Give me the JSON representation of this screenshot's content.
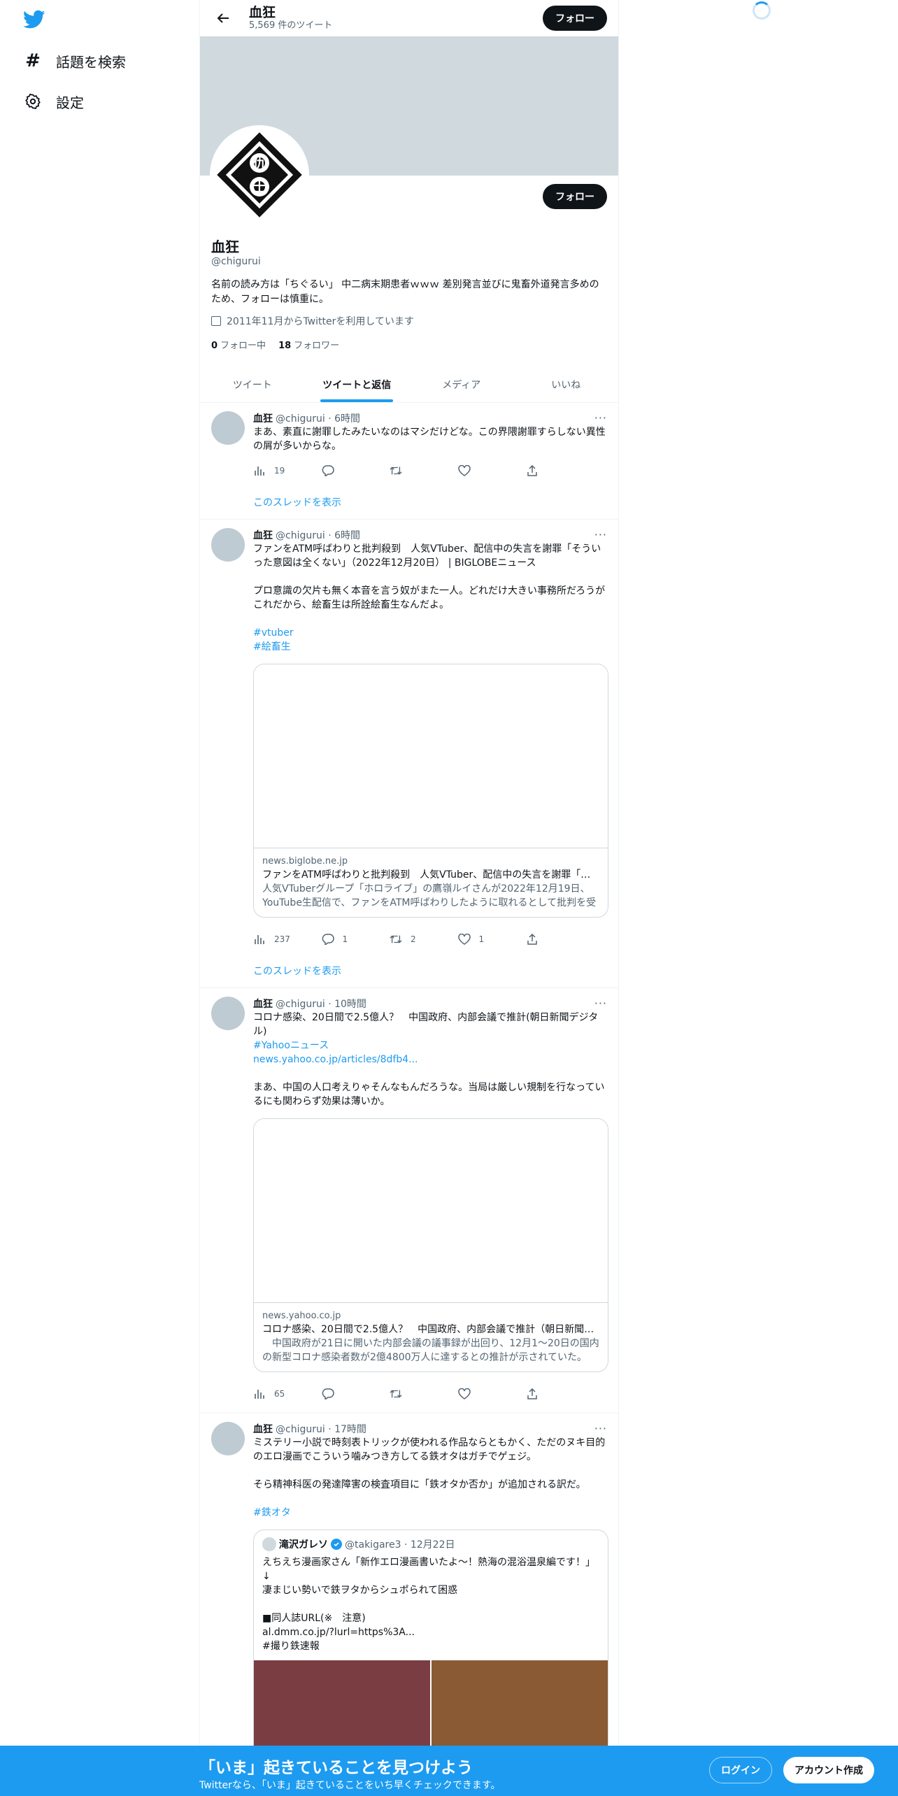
{
  "nav": {
    "logo": "twitter-bird-icon",
    "items": [
      {
        "icon": "hashtag-icon",
        "label": "話題を検索"
      },
      {
        "icon": "gear-icon",
        "label": "設定"
      }
    ]
  },
  "header": {
    "name": "血狂",
    "tweet_count": "5,569 件のツイート",
    "follow_label": "フォロー"
  },
  "profile": {
    "name": "血狂",
    "handle": "@chigurui",
    "bio": "名前の読み方は「ちぐるい」 中二病末期患者ｗｗｗ 差別発言並びに鬼畜外道発言多めのため、フォローは慎重に。",
    "joined": "2011年11月からTwitterを利用しています",
    "following_count": "0",
    "following_label": "フォロー中",
    "followers_count": "18",
    "followers_label": "フォロワー",
    "follow_label": "フォロー",
    "avatar_glyphs": {
      "top": "仇",
      "bottom": "士"
    }
  },
  "tabs": [
    {
      "label": "ツイート",
      "active": false
    },
    {
      "label": "ツイートと返信",
      "active": true
    },
    {
      "label": "メディア",
      "active": false
    },
    {
      "label": "いいね",
      "active": false
    }
  ],
  "tweets": [
    {
      "name": "血狂",
      "handle_time": "@chigurui · 6時間",
      "text": "まあ、素直に謝罪したみたいなのはマシだけどな。この界隈謝罪すらしない異性の屑が多いからな。",
      "views": "19",
      "replies": "",
      "retweets": "",
      "likes": "",
      "thread_label": "このスレッドを表示"
    },
    {
      "name": "血狂",
      "handle_time": "@chigurui · 6時間",
      "text": "ファンをATM呼ばわりと批判殺到　人気VTuber、配信中の失言を謝罪「そういった意図は全くない」（2022年12月20日） | BIGLOBEニュース\n\nプロ意識の欠片も無く本音を言う奴がまた一人。どれだけ大きい事務所だろうがこれだから、絵畜生は所詮絵畜生なんだよ。",
      "hashtags": [
        "#vtuber",
        "#絵畜生"
      ],
      "card": {
        "domain": "news.biglobe.ne.jp",
        "title": "ファンをATM呼ばわりと批判殺到　人気VTuber、配信中の失言を謝罪「そういった意図は全くない」",
        "desc": "人気VTuberグループ「ホロライブ」の鷹嶺ルイさんが2022年12月19日、YouTube生配信で、ファンをATM呼ばわりしたように取れるとして批判を受けた。"
      },
      "views": "237",
      "replies": "1",
      "retweets": "2",
      "likes": "1",
      "thread_label": "このスレッドを表示"
    },
    {
      "name": "血狂",
      "handle_time": "@chigurui · 10時間",
      "text": "コロナ感染、20日間で2.5億人？　中国政府、内部会議で推計(朝日新聞デジタル)",
      "links": [
        "#Yahooニュース",
        "news.yahoo.co.jp/articles/8dfb4..."
      ],
      "text2": "まあ、中国の人口考えりゃそんなもんだろうな。当局は厳しい規制を行なっているにも関わらず効果は薄いか。",
      "card": {
        "domain": "news.yahoo.co.jp",
        "title": "コロナ感染、20日間で2.5億人？　中国政府、内部会議で推計（朝日新聞デジタル）",
        "desc": "　中国政府が21日に開いた内部会議の議事録が出回り、12月1～20日の国内の新型コロナ感染者数が2億4800万人に達するとの推計が示されていた。"
      },
      "views": "65",
      "replies": "",
      "retweets": "",
      "likes": ""
    },
    {
      "name": "血狂",
      "handle_time": "@chigurui · 17時間",
      "text": "ミステリー小説で時刻表トリックが使われる作品ならともかく、ただのヌキ目的のエロ漫画でこういう噛みつき方してる鉄オタはガチでゲェジ。\n\nそら精神科医の発達障害の検査項目に「鉄オタか否か」が追加される訳だ。",
      "hashtags": [
        "#鉄オタ"
      ],
      "quote": {
        "name": "滝沢ガレソ",
        "handle_time": "@takigare3 · 12月22日",
        "text": "えちえち漫画家さん「新作エロ漫画書いたよ～！熱海の混浴温泉編です！」\n↓\n凄まじい勢いで鉄ヲタからシュポられて困惑\n\n■同人誌URL(※　注意)\nal.dmm.co.jp/?lurl=https%3A...\n#撮り鉄速報",
        "image_colors": [
          "#7a3e42",
          "#8a5a34"
        ]
      }
    }
  ],
  "bottom_bar": {
    "title": "「いま」起きていることを見つけよう",
    "subtitle": "Twitterなら、「いま」起きていることをいち早くチェックできます。",
    "login": "ログイン",
    "signup": "アカウント作成"
  },
  "colors": {
    "accent": "#1d9bf0",
    "text": "#0f1419",
    "muted": "#536471",
    "banner": "#cfd9de"
  }
}
